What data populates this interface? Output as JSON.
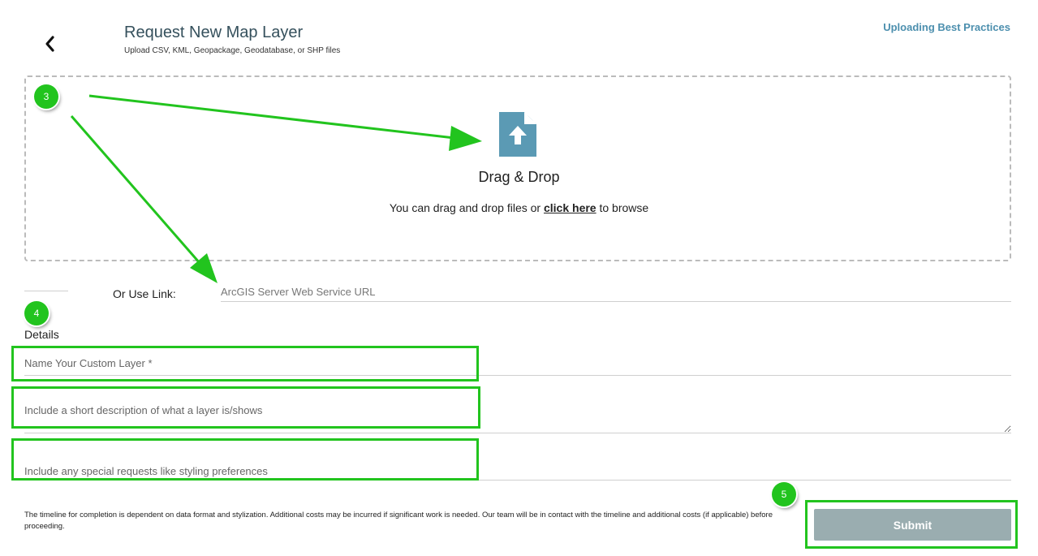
{
  "header": {
    "title": "Request New Map Layer",
    "subtitle": "Upload CSV, KML, Geopackage, Geodatabase, or SHP files",
    "best_practices_link": "Uploading Best Practices"
  },
  "dropzone": {
    "icon": "file-upload-icon",
    "title": "Drag & Drop",
    "text_before": "You can drag and drop files or ",
    "click_here": "click here",
    "text_after": " to browse"
  },
  "link_section": {
    "label": "Or Use Link:",
    "placeholder": "ArcGIS Server Web Service URL"
  },
  "details": {
    "heading": "Details",
    "name_placeholder": "Name Your Custom Layer *",
    "description_placeholder": "Include a short description of what a layer is/shows",
    "requests_placeholder": "Include any special requests like styling preferences"
  },
  "footer": {
    "timeline_text": "The timeline for completion is dependent on data format and stylization. Additional costs may be incurred if significant work is needed. Our team will be in contact with the timeline and additional costs (if applicable) before proceeding.",
    "submit_label": "Submit"
  },
  "annotations": {
    "badges": [
      "3",
      "4",
      "5"
    ],
    "color": "#22c41e"
  },
  "colors": {
    "title": "#35505c",
    "link": "#4c8fae",
    "icon": "#5b9ab4",
    "submit_bg": "#9aadb0"
  }
}
